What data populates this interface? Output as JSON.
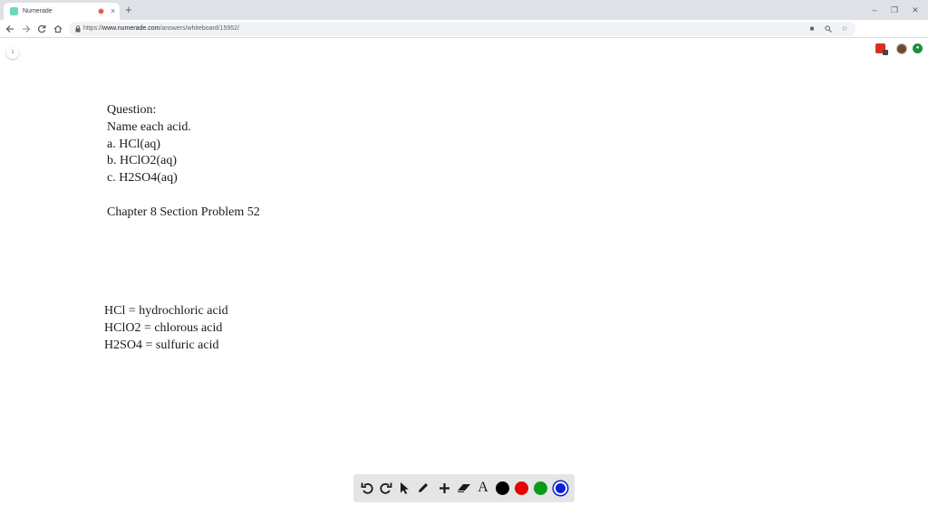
{
  "browser": {
    "tab_title": "Numerade",
    "tab_close": "×",
    "new_tab": "+",
    "window_buttons": [
      "–",
      "❐",
      "✕"
    ],
    "url_scheme": "https://",
    "url_host": "www.numerade.com",
    "url_path": "/answers/whiteboard/15952/"
  },
  "page": {
    "page_number": "1"
  },
  "question": {
    "lines": [
      "Question:",
      "Name each acid.",
      "a. HCl(aq)",
      "b. HClO2(aq)",
      "c. H2SO4(aq)"
    ],
    "source": "Chapter 8 Section Problem 52"
  },
  "answer": {
    "lines": [
      "HCl = hydrochloric acid",
      "HClO2 = chlorous acid",
      "H2SO4 = sulfuric acid"
    ]
  },
  "draw_toolbar": {
    "text_tool_label": "A",
    "colors": {
      "black": "#000000",
      "red": "#e60000",
      "green": "#0a9a1a",
      "blue": "#0a1fd6"
    }
  }
}
